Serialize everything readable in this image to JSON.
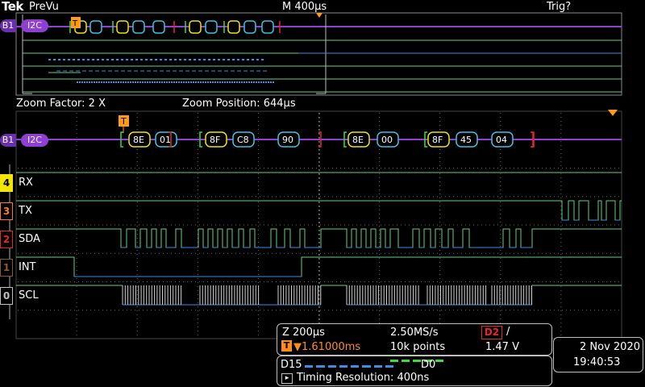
{
  "header": {
    "logo": "Tek",
    "mode": "PreVu",
    "timebase": "M 400µs",
    "trigger_status": "Trig?"
  },
  "zoom_info": {
    "factor": "Zoom Factor: 2 X",
    "position": "Zoom Position: 644µs"
  },
  "bus": {
    "tag": "B1",
    "label": "I2C"
  },
  "decode_packets": [
    {
      "bytes": [
        "8E",
        "01"
      ]
    },
    {
      "bytes": [
        "8F",
        "C8",
        "90"
      ]
    },
    {
      "bytes": [
        "8E",
        "00"
      ]
    },
    {
      "bytes": [
        "8F",
        "45",
        "04"
      ]
    }
  ],
  "channels": [
    {
      "num": "4",
      "name": "RX",
      "color": "#f2e600"
    },
    {
      "num": "3",
      "name": "TX",
      "color": "#ff7a1a"
    },
    {
      "num": "2",
      "name": "SDA",
      "color": "#e6262a"
    },
    {
      "num": "1",
      "name": "INT",
      "color": "#8a5a2b"
    },
    {
      "num": "0",
      "name": "SCL",
      "color": "#bfbfbf"
    }
  ],
  "readouts": {
    "zoom": "Z 200µs",
    "trigger_marker": "T",
    "trigger_time": "▼1.61000ms",
    "sample_rate": "2.50MS/s",
    "record_length": "10k points",
    "trigger_source": "D2",
    "trigger_slope": "/",
    "trigger_level": "1.47 V",
    "digital_range_left": "D15",
    "digital_range_right": "D0",
    "timing_resolution": "Timing Resolution: 400ns"
  },
  "datetime": {
    "date": "2 Nov 2020",
    "time": "19:40:53"
  },
  "colors": {
    "trace_green": "#5fd18a",
    "trace_blue": "#3a8ee6",
    "bus_purple": "#8f3fd6",
    "packet_yellow": "#f2e600",
    "packet_cyan": "#39c6e6",
    "start_green": "#3fd93f",
    "stop_red": "#e6262a",
    "trigger_orange": "#ff9a1a",
    "grid": "#666666"
  }
}
